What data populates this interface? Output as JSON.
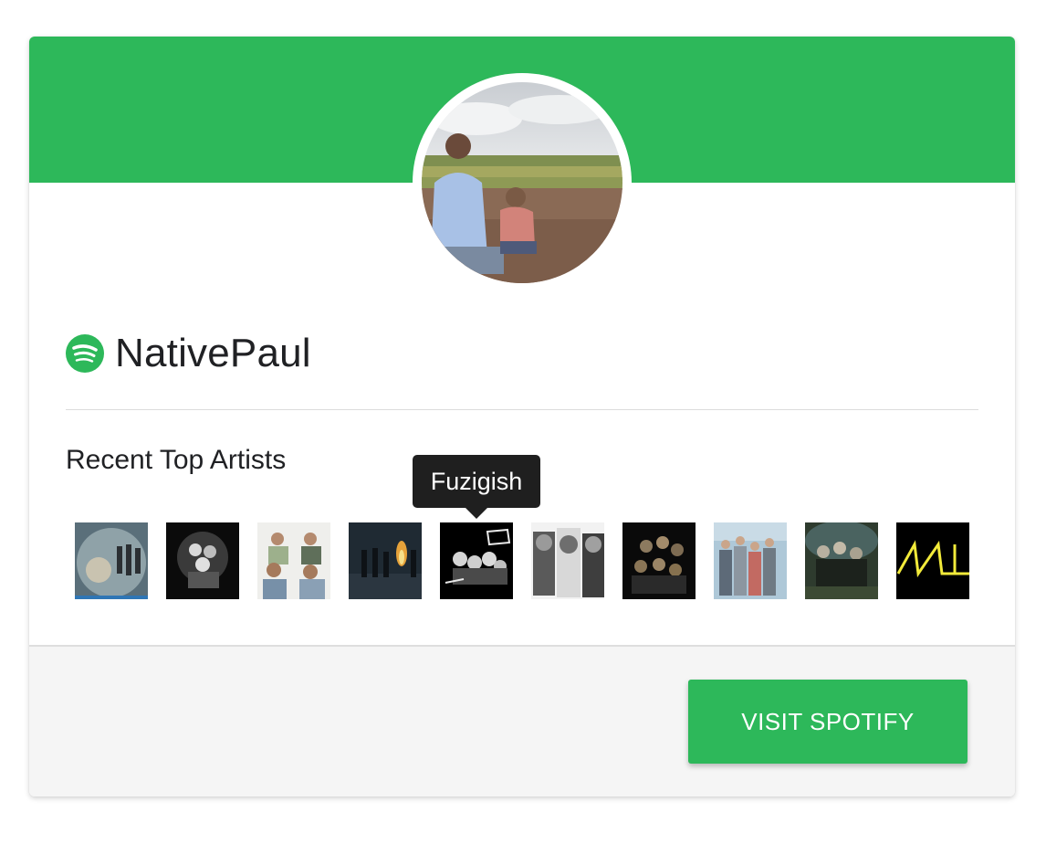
{
  "colors": {
    "brand_green": "#2db85a",
    "tooltip_bg": "#1f1f1f",
    "footer_bg": "#f5f5f5"
  },
  "profile": {
    "username": "NativePaul",
    "avatar_icon": "profile-photo",
    "service_icon": "spotify-icon"
  },
  "top_artists": {
    "title": "Recent Top Artists",
    "tooltip": "Fuzigish",
    "hovered_index": 4,
    "items": [
      {
        "icon": "artist-photo-1"
      },
      {
        "icon": "artist-photo-2"
      },
      {
        "icon": "artist-photo-3"
      },
      {
        "icon": "artist-photo-4"
      },
      {
        "icon": "artist-photo-5",
        "name": "Fuzigish"
      },
      {
        "icon": "artist-photo-6"
      },
      {
        "icon": "artist-photo-7"
      },
      {
        "icon": "artist-photo-8"
      },
      {
        "icon": "artist-photo-9"
      },
      {
        "icon": "artist-photo-10"
      }
    ]
  },
  "footer": {
    "button_label": "VISIT SPOTIFY"
  }
}
